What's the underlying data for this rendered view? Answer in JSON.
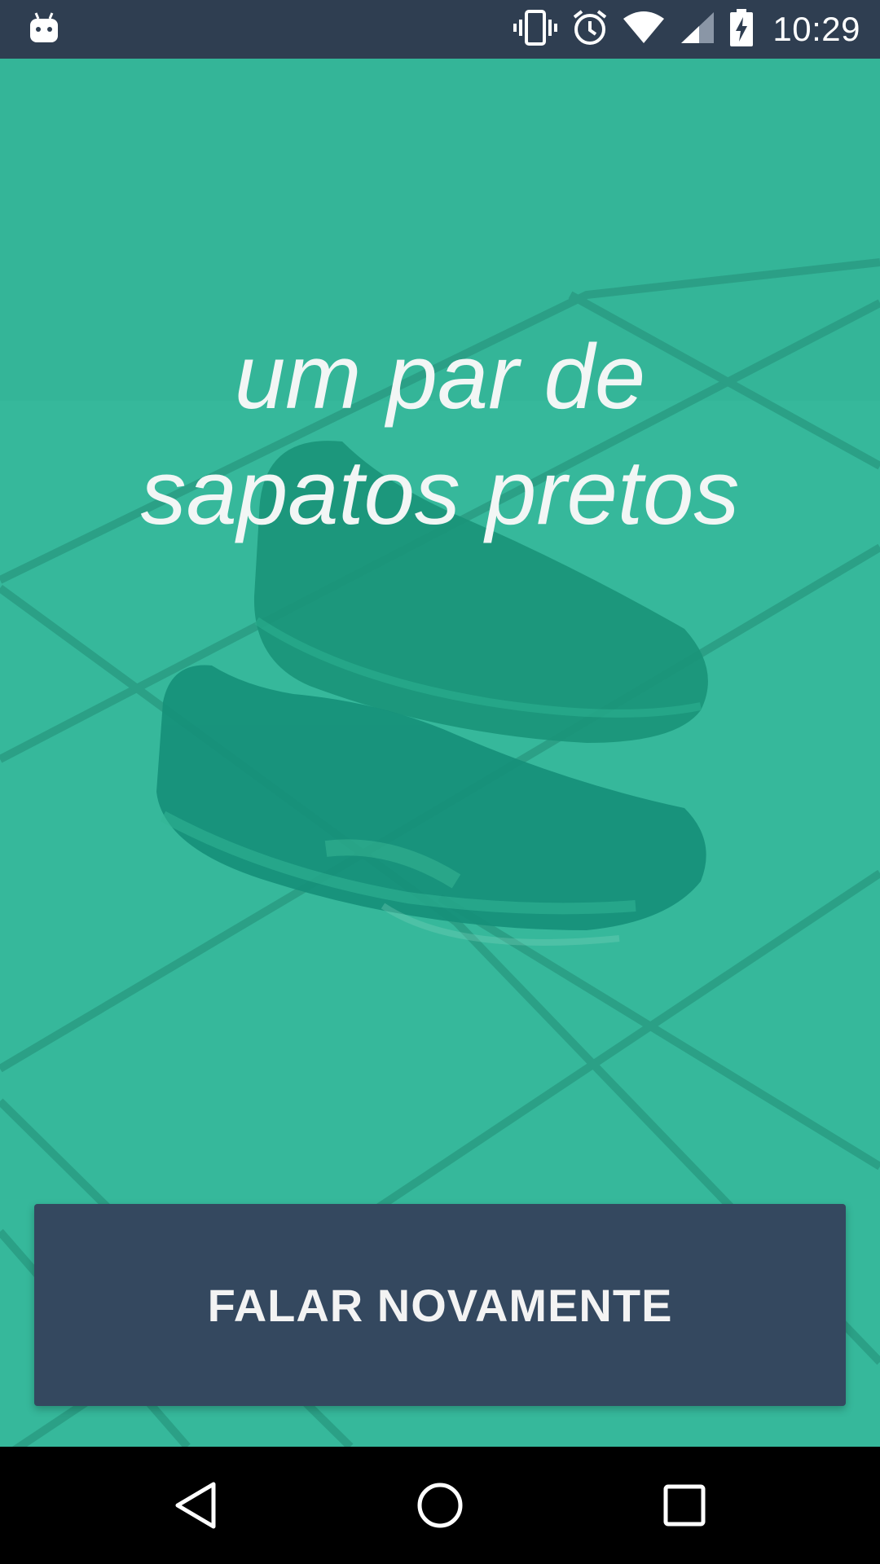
{
  "status_bar": {
    "time": "10:29",
    "icons": [
      "android-debug-icon",
      "vibrate-icon",
      "alarm-icon",
      "wifi-icon",
      "cell-signal-icon",
      "battery-charging-icon"
    ]
  },
  "main": {
    "phrase_line1": "um par de",
    "phrase_line2": "sapatos pretos",
    "background_image": "black-sneakers-on-tiles-photo",
    "accent_color": "#36b89b"
  },
  "actions": {
    "speak_again_label": "FALAR NOVAMENTE",
    "button_color": "#34485f"
  },
  "nav_bar": {
    "icons": [
      "back-icon",
      "home-icon",
      "recents-icon"
    ]
  }
}
